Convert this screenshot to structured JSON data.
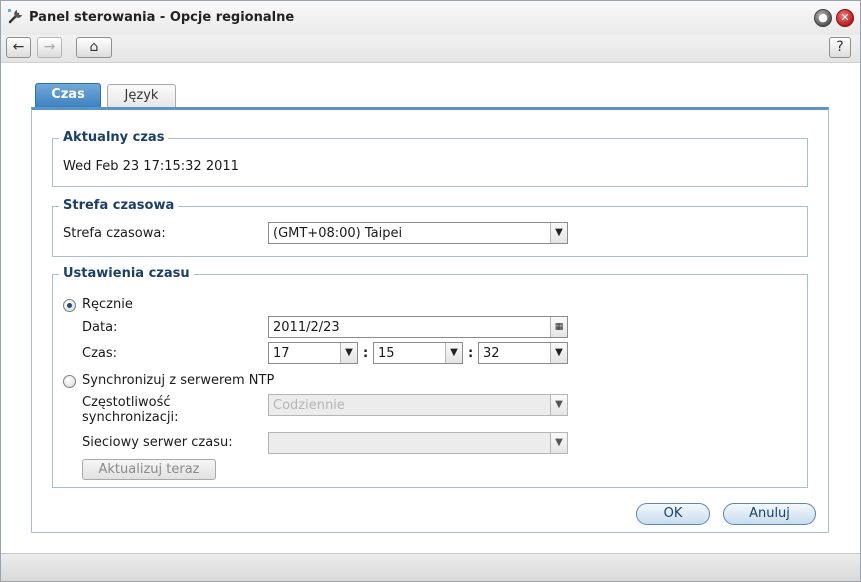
{
  "window": {
    "title": "Panel sterowania - Opcje regionalne",
    "icons": {
      "app": "wrench-icon",
      "minimize": "minimize-icon",
      "close": "close-icon"
    }
  },
  "toolbar": {
    "back_icon": "←",
    "forward_icon": "→",
    "home_icon": "⌂",
    "help_icon": "?"
  },
  "tabs": [
    {
      "label": "Czas",
      "active": true
    },
    {
      "label": "Język",
      "active": false
    }
  ],
  "current_time": {
    "legend": "Aktualny czas",
    "value": "Wed Feb 23 17:15:32 2011"
  },
  "timezone": {
    "legend": "Strefa czasowa",
    "label": "Strefa czasowa:",
    "value": "(GMT+08:00) Taipei"
  },
  "time_settings": {
    "legend": "Ustawienia czasu",
    "manual": {
      "label": "Ręcznie",
      "checked": true,
      "date_label": "Data:",
      "date_value": "2011/2/23",
      "time_label": "Czas:",
      "hour": "17",
      "minute": "15",
      "second": "32",
      "separator": ":"
    },
    "ntp": {
      "label": "Synchronizuj z serwerem NTP",
      "checked": false,
      "frequency_label": "Częstotliwość synchronizacji:",
      "frequency_value": "Codziennie",
      "server_label": "Sieciowy serwer czasu:",
      "server_value": "",
      "update_button": "Aktualizuj teraz"
    }
  },
  "buttons": {
    "ok": "OK",
    "cancel": "Anuluj"
  },
  "colors": {
    "accent": "#3d80c0",
    "legend_text": "#1d3f66",
    "close_button": "#b51d1d"
  }
}
